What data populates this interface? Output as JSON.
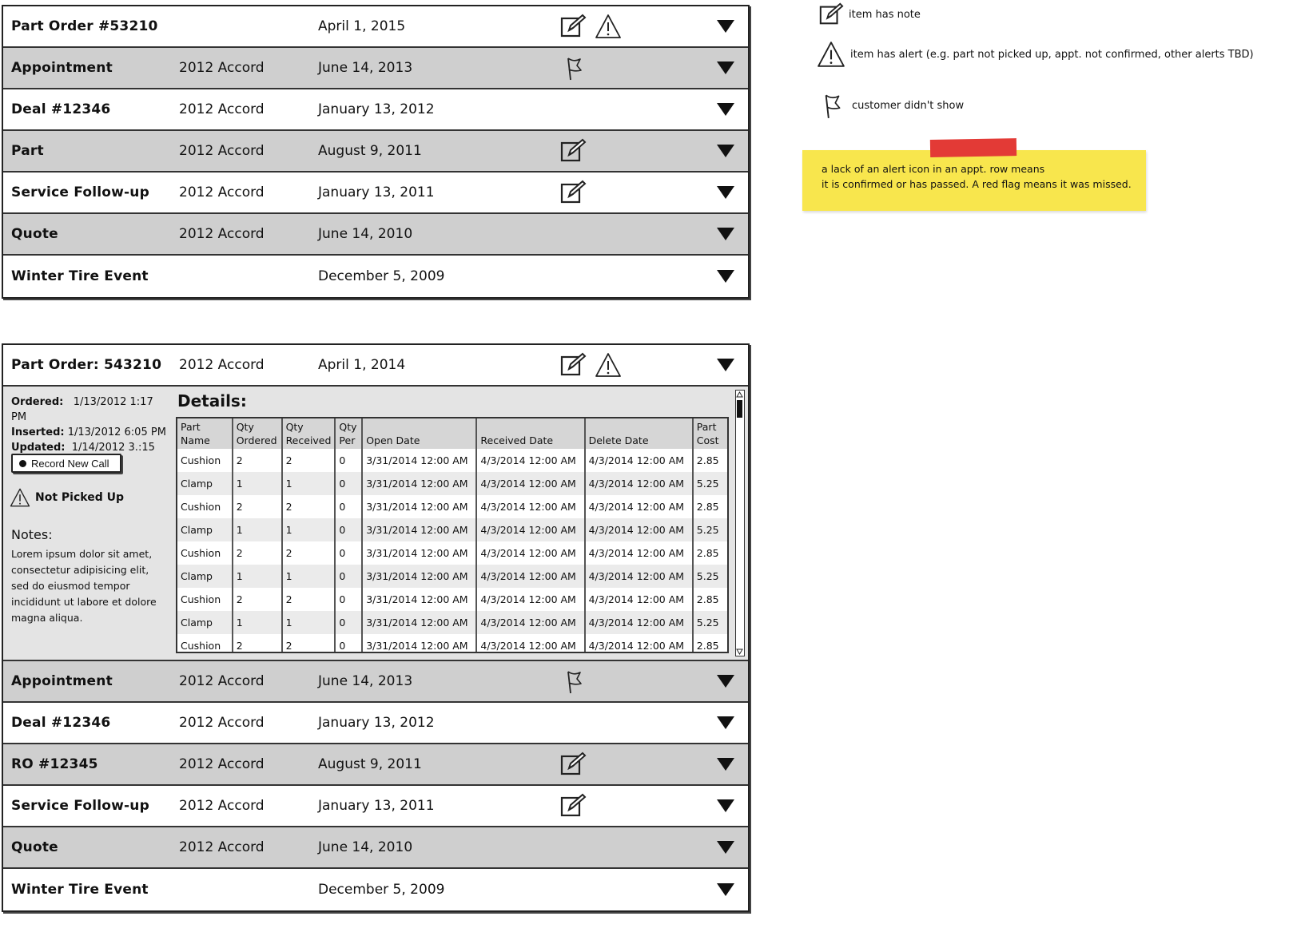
{
  "list1": {
    "rows": [
      {
        "title": "Part Order #53210",
        "model": "",
        "date": "April 1, 2015",
        "icons": [
          "note-icon",
          "alert-icon"
        ]
      },
      {
        "title": "Appointment",
        "model": "2012 Accord",
        "date": "June 14, 2013",
        "icons": [
          "flag-icon"
        ]
      },
      {
        "title": "Deal #12346",
        "model": "2012 Accord",
        "date": "January 13, 2012",
        "icons": []
      },
      {
        "title": "Part",
        "model": "2012 Accord",
        "date": "August 9, 2011",
        "icons": [
          "note-icon"
        ]
      },
      {
        "title": "Service Follow-up",
        "model": "2012 Accord",
        "date": "January 13, 2011",
        "icons": [
          "note-icon"
        ]
      },
      {
        "title": "Quote",
        "model": "2012 Accord",
        "date": "June 14, 2010",
        "icons": []
      },
      {
        "title": "Winter Tire Event",
        "model": "",
        "date": "December 5, 2009",
        "icons": []
      }
    ]
  },
  "list2": {
    "header": {
      "title": "Part Order: 543210",
      "model": "2012 Accord",
      "date": "April 1, 2014",
      "icons": [
        "note-icon",
        "alert-icon"
      ]
    },
    "meta": {
      "ordered_label": "Ordered:",
      "ordered": "1/13/2012 1:17 PM",
      "inserted_label": "Inserted:",
      "inserted": "1/13/2012 6:05 PM",
      "updated_label": "Updated:",
      "updated": "1/14/2012 3.:15 PM"
    },
    "record_button": "Record New Call",
    "status": "Not Picked Up",
    "notes_label": "Notes:",
    "notes_text": "Lorem ipsum dolor sit amet, consectetur adipisicing elit, sed do eiusmod tempor incididunt ut labore et dolore magna aliqua.",
    "details_title": "Details:",
    "columns": [
      "Part Name",
      "Qty Ordered",
      "Qty Received",
      "Qty Per",
      "Open Date",
      "Received Date",
      "Delete Date",
      "Part Cost"
    ],
    "table_rows": [
      [
        "Cushion",
        "2",
        "2",
        "0",
        "3/31/2014 12:00 AM",
        "4/3/2014 12:00 AM",
        "4/3/2014 12:00 AM",
        "2.85"
      ],
      [
        "Clamp",
        "1",
        "1",
        "0",
        "3/31/2014 12:00 AM",
        "4/3/2014 12:00 AM",
        "4/3/2014 12:00 AM",
        "5.25"
      ],
      [
        "Cushion",
        "2",
        "2",
        "0",
        "3/31/2014 12:00 AM",
        "4/3/2014 12:00 AM",
        "4/3/2014 12:00 AM",
        "2.85"
      ],
      [
        "Clamp",
        "1",
        "1",
        "0",
        "3/31/2014 12:00 AM",
        "4/3/2014 12:00 AM",
        "4/3/2014 12:00 AM",
        "5.25"
      ],
      [
        "Cushion",
        "2",
        "2",
        "0",
        "3/31/2014 12:00 AM",
        "4/3/2014 12:00 AM",
        "4/3/2014 12:00 AM",
        "2.85"
      ],
      [
        "Clamp",
        "1",
        "1",
        "0",
        "3/31/2014 12:00 AM",
        "4/3/2014 12:00 AM",
        "4/3/2014 12:00 AM",
        "5.25"
      ],
      [
        "Cushion",
        "2",
        "2",
        "0",
        "3/31/2014 12:00 AM",
        "4/3/2014 12:00 AM",
        "4/3/2014 12:00 AM",
        "2.85"
      ],
      [
        "Clamp",
        "1",
        "1",
        "0",
        "3/31/2014 12:00 AM",
        "4/3/2014 12:00 AM",
        "4/3/2014 12:00 AM",
        "5.25"
      ],
      [
        "Cushion",
        "2",
        "2",
        "0",
        "3/31/2014 12:00 AM",
        "4/3/2014 12:00 AM",
        "4/3/2014 12:00 AM",
        "2.85"
      ]
    ],
    "rows": [
      {
        "title": "Appointment",
        "model": "2012 Accord",
        "date": "June 14, 2013",
        "icons": [
          "flag-icon"
        ]
      },
      {
        "title": "Deal #12346",
        "model": "2012 Accord",
        "date": "January 13, 2012",
        "icons": []
      },
      {
        "title": "RO #12345",
        "model": "2012 Accord",
        "date": "August 9, 2011",
        "icons": [
          "note-icon"
        ]
      },
      {
        "title": "Service Follow-up",
        "model": "2012 Accord",
        "date": "January 13, 2011",
        "icons": [
          "note-icon"
        ]
      },
      {
        "title": "Quote",
        "model": "2012 Accord",
        "date": "June 14, 2010",
        "icons": []
      },
      {
        "title": "Winter Tire Event",
        "model": "",
        "date": "December 5, 2009",
        "icons": []
      }
    ]
  },
  "legend": {
    "note": "item has note",
    "alert": "item has alert (e.g. part not picked up, appt. not confirmed, other alerts TBD)",
    "flag": "customer didn't show"
  },
  "sticky_note": {
    "line1": "a lack of an alert icon in an appt. row means",
    "line2": "it is confirmed or has passed. A red flag means it was missed."
  },
  "colors": {
    "row_grey": "#cfcfcf",
    "sticky": "#f8e64d",
    "tape": "#e33a36"
  }
}
